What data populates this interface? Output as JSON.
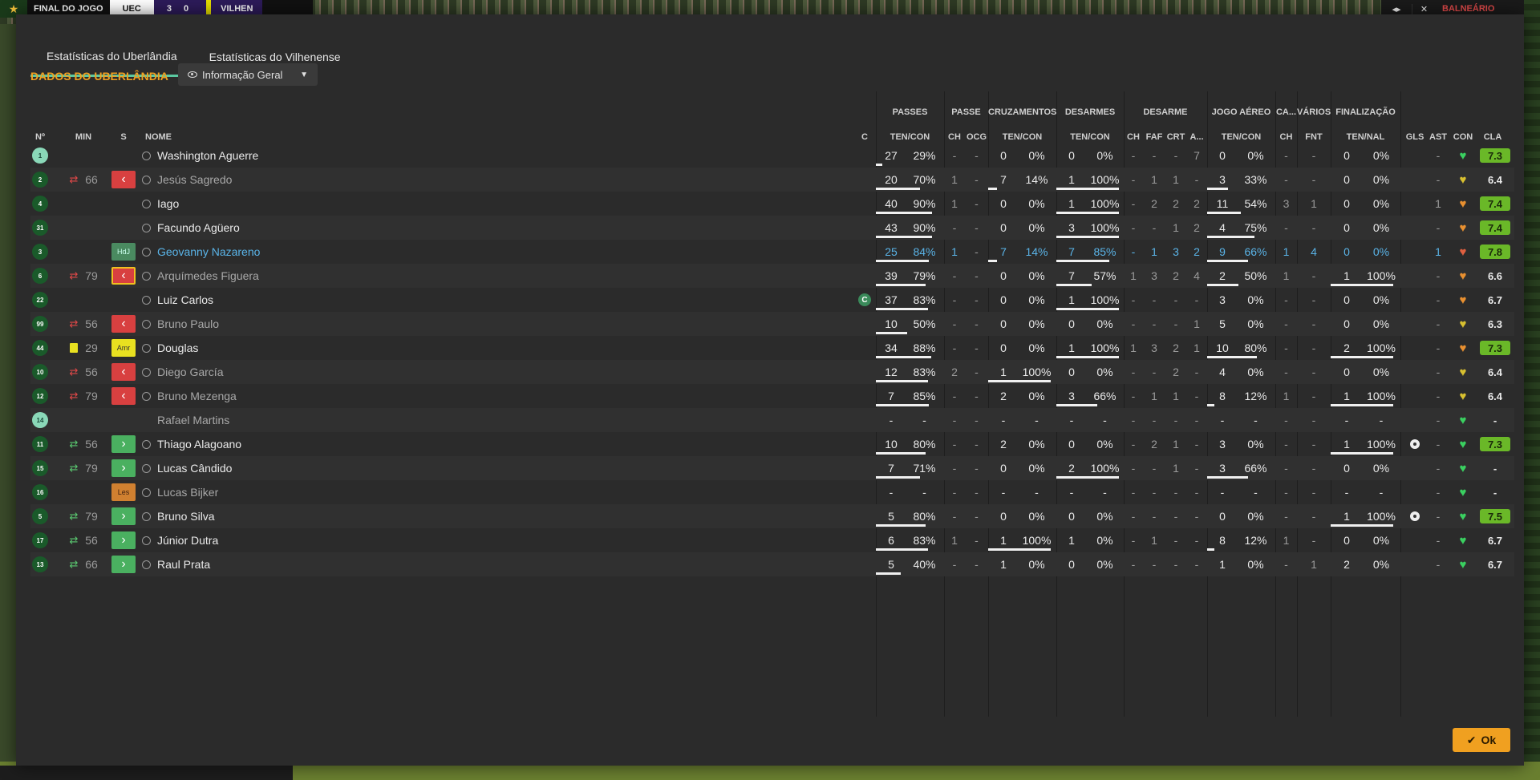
{
  "scorebar": {
    "logo": "★",
    "status": "FINAL DO JOGO",
    "team1": "UEC",
    "score": "3 0",
    "team2": "VILHEN"
  },
  "topright": {
    "b1": "◂▸",
    "b2": "✕",
    "label": "BALNEÁRIO"
  },
  "tabs": [
    "Estatísticas do Uberlândia",
    "Estatísticas do Vilhenense"
  ],
  "section_title": "DADOS DO UBERLÂNDIA",
  "dropdown": {
    "label": "Informação Geral"
  },
  "groups": {
    "passes": "PASSES",
    "passe": "PASSE",
    "cruz": "CRUZAMENTOS",
    "desarmes": "DESARMES",
    "desarme": "DESARME",
    "aereo": "JOGO AÉREO",
    "ca": "CA...",
    "varios": "VÁRIOS",
    "final": "FINALIZAÇÃO"
  },
  "headers": {
    "num": "Nº",
    "min": "MIN",
    "s": "S",
    "nome": "NOME",
    "c": "C",
    "passes_tc": "TEN/CON",
    "passe_ch": "CH",
    "passe_ocg": "OCG",
    "cruz_tc": "TEN/CON",
    "des_tc": "TEN/CON",
    "d_ch": "CH",
    "d_faf": "FAF",
    "d_crt": "CRT",
    "d_a": "A...",
    "aer_tc": "TEN/CON",
    "ca_ch": "CH",
    "v_fnt": "FNT",
    "fin_tn": "TEN/NAL",
    "gls": "GLS",
    "ast": "AST",
    "con": "CON",
    "cla": "CLA"
  },
  "ok_button": {
    "icon": "✔",
    "label": "Ok"
  },
  "players": [
    {
      "num": "1",
      "gk": true,
      "min": "",
      "sub": "",
      "status": "",
      "name": "Washington Aguerre",
      "style": "",
      "capt": false,
      "p": [
        "27",
        "29%"
      ],
      "ch": "-",
      "ocg": "-",
      "cr": [
        "0",
        "0%"
      ],
      "de": [
        "0",
        "0%"
      ],
      "dch": "-",
      "faf": "-",
      "crt": "-",
      "da": "7",
      "ae": [
        "0",
        "0%"
      ],
      "cach": "-",
      "fnt": "-",
      "fi": [
        "0",
        "0%"
      ],
      "gls": "",
      "ast": "-",
      "con": "green",
      "cla": "7.3",
      "cla_good": true,
      "bars": {
        "p": 0.1,
        "cr": 0,
        "de": 0,
        "ae": 0,
        "fi": 0
      }
    },
    {
      "num": "2",
      "gk": false,
      "min": "66",
      "sub": "out",
      "status": "out",
      "name": "Jesús Sagredo",
      "style": "dim",
      "capt": false,
      "p": [
        "20",
        "70%"
      ],
      "ch": "1",
      "ocg": "-",
      "cr": [
        "7",
        "14%"
      ],
      "de": [
        "1",
        "100%"
      ],
      "dch": "-",
      "faf": "1",
      "crt": "1",
      "da": "-",
      "ae": [
        "3",
        "33%"
      ],
      "cach": "-",
      "fnt": "-",
      "fi": [
        "0",
        "0%"
      ],
      "gls": "",
      "ast": "-",
      "con": "yellow",
      "cla": "6.4",
      "cla_good": false,
      "bars": {
        "p": 0.7,
        "cr": 0.14,
        "de": 1,
        "ae": 0.33,
        "fi": 0
      }
    },
    {
      "num": "4",
      "gk": false,
      "min": "",
      "sub": "",
      "status": "",
      "name": "Iago",
      "style": "",
      "capt": false,
      "p": [
        "40",
        "90%"
      ],
      "ch": "1",
      "ocg": "-",
      "cr": [
        "0",
        "0%"
      ],
      "de": [
        "1",
        "100%"
      ],
      "dch": "-",
      "faf": "2",
      "crt": "2",
      "da": "2",
      "ae": [
        "11",
        "54%"
      ],
      "cach": "3",
      "fnt": "1",
      "fi": [
        "0",
        "0%"
      ],
      "gls": "",
      "ast": "1",
      "con": "orange",
      "cla": "7.4",
      "cla_good": true,
      "bars": {
        "p": 0.9,
        "cr": 0,
        "de": 1,
        "ae": 0.54,
        "fi": 0
      }
    },
    {
      "num": "31",
      "gk": false,
      "min": "",
      "sub": "",
      "status": "",
      "name": "Facundo Agüero",
      "style": "",
      "capt": false,
      "p": [
        "43",
        "90%"
      ],
      "ch": "-",
      "ocg": "-",
      "cr": [
        "0",
        "0%"
      ],
      "de": [
        "3",
        "100%"
      ],
      "dch": "-",
      "faf": "-",
      "crt": "1",
      "da": "2",
      "ae": [
        "4",
        "75%"
      ],
      "cach": "-",
      "fnt": "-",
      "fi": [
        "0",
        "0%"
      ],
      "gls": "",
      "ast": "-",
      "con": "orange",
      "cla": "7.4",
      "cla_good": true,
      "bars": {
        "p": 0.9,
        "cr": 0,
        "de": 1,
        "ae": 0.75,
        "fi": 0
      }
    },
    {
      "num": "3",
      "gk": false,
      "min": "",
      "sub": "",
      "status": "hdj",
      "name": "Geovanny Nazareno",
      "style": "hl",
      "capt": false,
      "p": [
        "25",
        "84%"
      ],
      "ch": "1",
      "ocg": "-",
      "cr": [
        "7",
        "14%"
      ],
      "de": [
        "7",
        "85%"
      ],
      "dch": "-",
      "faf": "1",
      "crt": "3",
      "da": "2",
      "ae": [
        "9",
        "66%"
      ],
      "cach": "1",
      "fnt": "4",
      "fi": [
        "0",
        "0%"
      ],
      "gls": "",
      "ast": "1",
      "con": "red",
      "cla": "7.8",
      "cla_good": true,
      "bars": {
        "p": 0.84,
        "cr": 0.14,
        "de": 0.85,
        "ae": 0.66,
        "fi": 0
      }
    },
    {
      "num": "6",
      "gk": false,
      "min": "79",
      "sub": "out",
      "status": "outbox",
      "name": "Arquímedes Figuera",
      "style": "dim",
      "capt": false,
      "p": [
        "39",
        "79%"
      ],
      "ch": "-",
      "ocg": "-",
      "cr": [
        "0",
        "0%"
      ],
      "de": [
        "7",
        "57%"
      ],
      "dch": "1",
      "faf": "3",
      "crt": "2",
      "da": "4",
      "ae": [
        "2",
        "50%"
      ],
      "cach": "1",
      "fnt": "-",
      "fi": [
        "1",
        "100%"
      ],
      "gls": "",
      "ast": "-",
      "con": "orange",
      "cla": "6.6",
      "cla_good": false,
      "bars": {
        "p": 0.79,
        "cr": 0,
        "de": 0.57,
        "ae": 0.5,
        "fi": 1
      }
    },
    {
      "num": "22",
      "gk": false,
      "min": "",
      "sub": "",
      "status": "",
      "name": "Luiz Carlos",
      "style": "",
      "capt": true,
      "p": [
        "37",
        "83%"
      ],
      "ch": "-",
      "ocg": "-",
      "cr": [
        "0",
        "0%"
      ],
      "de": [
        "1",
        "100%"
      ],
      "dch": "-",
      "faf": "-",
      "crt": "-",
      "da": "-",
      "ae": [
        "3",
        "0%"
      ],
      "cach": "-",
      "fnt": "-",
      "fi": [
        "0",
        "0%"
      ],
      "gls": "",
      "ast": "-",
      "con": "orange",
      "cla": "6.7",
      "cla_good": false,
      "bars": {
        "p": 0.83,
        "cr": 0,
        "de": 1,
        "ae": 0,
        "fi": 0
      }
    },
    {
      "num": "99",
      "gk": false,
      "min": "56",
      "sub": "out",
      "status": "out",
      "name": "Bruno Paulo",
      "style": "dim",
      "capt": false,
      "p": [
        "10",
        "50%"
      ],
      "ch": "-",
      "ocg": "-",
      "cr": [
        "0",
        "0%"
      ],
      "de": [
        "0",
        "0%"
      ],
      "dch": "-",
      "faf": "-",
      "crt": "-",
      "da": "1",
      "ae": [
        "5",
        "0%"
      ],
      "cach": "-",
      "fnt": "-",
      "fi": [
        "0",
        "0%"
      ],
      "gls": "",
      "ast": "-",
      "con": "yellow",
      "cla": "6.3",
      "cla_good": false,
      "bars": {
        "p": 0.5,
        "cr": 0,
        "de": 0,
        "ae": 0,
        "fi": 0
      }
    },
    {
      "num": "44",
      "gk": false,
      "min": "29",
      "sub": "card",
      "status": "amr",
      "name": "Douglas",
      "style": "",
      "capt": false,
      "p": [
        "34",
        "88%"
      ],
      "ch": "-",
      "ocg": "-",
      "cr": [
        "0",
        "0%"
      ],
      "de": [
        "1",
        "100%"
      ],
      "dch": "1",
      "faf": "3",
      "crt": "2",
      "da": "1",
      "ae": [
        "10",
        "80%"
      ],
      "cach": "-",
      "fnt": "-",
      "fi": [
        "2",
        "100%"
      ],
      "gls": "",
      "ast": "-",
      "con": "orange",
      "cla": "7.3",
      "cla_good": true,
      "bars": {
        "p": 0.88,
        "cr": 0,
        "de": 1,
        "ae": 0.8,
        "fi": 1
      }
    },
    {
      "num": "10",
      "gk": false,
      "min": "56",
      "sub": "out",
      "status": "out",
      "name": "Diego García",
      "style": "dim",
      "capt": false,
      "p": [
        "12",
        "83%"
      ],
      "ch": "2",
      "ocg": "-",
      "cr": [
        "1",
        "100%"
      ],
      "de": [
        "0",
        "0%"
      ],
      "dch": "-",
      "faf": "-",
      "crt": "2",
      "da": "-",
      "ae": [
        "4",
        "0%"
      ],
      "cach": "-",
      "fnt": "-",
      "fi": [
        "0",
        "0%"
      ],
      "gls": "",
      "ast": "-",
      "con": "yellow",
      "cla": "6.4",
      "cla_good": false,
      "bars": {
        "p": 0.83,
        "cr": 1,
        "de": 0,
        "ae": 0,
        "fi": 0
      }
    },
    {
      "num": "12",
      "gk": false,
      "min": "79",
      "sub": "out",
      "status": "out",
      "name": "Bruno Mezenga",
      "style": "dim",
      "capt": false,
      "p": [
        "7",
        "85%"
      ],
      "ch": "-",
      "ocg": "-",
      "cr": [
        "2",
        "0%"
      ],
      "de": [
        "3",
        "66%"
      ],
      "dch": "-",
      "faf": "1",
      "crt": "1",
      "da": "-",
      "ae": [
        "8",
        "12%"
      ],
      "cach": "1",
      "fnt": "-",
      "fi": [
        "1",
        "100%"
      ],
      "gls": "",
      "ast": "-",
      "con": "yellow",
      "cla": "6.4",
      "cla_good": false,
      "bars": {
        "p": 0.85,
        "cr": 0,
        "de": 0.66,
        "ae": 0.12,
        "fi": 1
      }
    },
    {
      "num": "14",
      "gk": true,
      "min": "",
      "sub": "",
      "status": "",
      "name": "Rafael Martins",
      "style": "dim",
      "capt": false,
      "p": [
        "-",
        "-"
      ],
      "ch": "-",
      "ocg": "-",
      "cr": [
        "-",
        "-"
      ],
      "de": [
        "-",
        "-"
      ],
      "dch": "-",
      "faf": "-",
      "crt": "-",
      "da": "-",
      "ae": [
        "-",
        "-"
      ],
      "cach": "-",
      "fnt": "-",
      "fi": [
        "-",
        "-"
      ],
      "gls": "",
      "ast": "-",
      "con": "green",
      "cla": "-",
      "cla_good": false,
      "bars": {
        "p": 0,
        "cr": 0,
        "de": 0,
        "ae": 0,
        "fi": 0
      }
    },
    {
      "num": "11",
      "gk": false,
      "min": "56",
      "sub": "in",
      "status": "in",
      "name": "Thiago Alagoano",
      "style": "",
      "capt": false,
      "p": [
        "10",
        "80%"
      ],
      "ch": "-",
      "ocg": "-",
      "cr": [
        "2",
        "0%"
      ],
      "de": [
        "0",
        "0%"
      ],
      "dch": "-",
      "faf": "2",
      "crt": "1",
      "da": "-",
      "ae": [
        "3",
        "0%"
      ],
      "cach": "-",
      "fnt": "-",
      "fi": [
        "1",
        "100%"
      ],
      "gls": "ball",
      "ast": "-",
      "con": "green",
      "cla": "7.3",
      "cla_good": true,
      "bars": {
        "p": 0.8,
        "cr": 0,
        "de": 0,
        "ae": 0,
        "fi": 1
      }
    },
    {
      "num": "15",
      "gk": false,
      "min": "79",
      "sub": "in",
      "status": "in",
      "name": "Lucas Cândido",
      "style": "",
      "capt": false,
      "p": [
        "7",
        "71%"
      ],
      "ch": "-",
      "ocg": "-",
      "cr": [
        "0",
        "0%"
      ],
      "de": [
        "2",
        "100%"
      ],
      "dch": "-",
      "faf": "-",
      "crt": "1",
      "da": "-",
      "ae": [
        "3",
        "66%"
      ],
      "cach": "-",
      "fnt": "-",
      "fi": [
        "0",
        "0%"
      ],
      "gls": "",
      "ast": "-",
      "con": "green",
      "cla": "-",
      "cla_good": false,
      "bars": {
        "p": 0.71,
        "cr": 0,
        "de": 1,
        "ae": 0.66,
        "fi": 0
      }
    },
    {
      "num": "16",
      "gk": false,
      "min": "",
      "sub": "",
      "status": "les",
      "name": "Lucas Bijker",
      "style": "dim",
      "capt": false,
      "p": [
        "-",
        "-"
      ],
      "ch": "-",
      "ocg": "-",
      "cr": [
        "-",
        "-"
      ],
      "de": [
        "-",
        "-"
      ],
      "dch": "-",
      "faf": "-",
      "crt": "-",
      "da": "-",
      "ae": [
        "-",
        "-"
      ],
      "cach": "-",
      "fnt": "-",
      "fi": [
        "-",
        "-"
      ],
      "gls": "",
      "ast": "-",
      "con": "green",
      "cla": "-",
      "cla_good": false,
      "bars": {
        "p": 0,
        "cr": 0,
        "de": 0,
        "ae": 0,
        "fi": 0
      }
    },
    {
      "num": "5",
      "gk": false,
      "min": "79",
      "sub": "in",
      "status": "in",
      "name": "Bruno Silva",
      "style": "",
      "capt": false,
      "p": [
        "5",
        "80%"
      ],
      "ch": "-",
      "ocg": "-",
      "cr": [
        "0",
        "0%"
      ],
      "de": [
        "0",
        "0%"
      ],
      "dch": "-",
      "faf": "-",
      "crt": "-",
      "da": "-",
      "ae": [
        "0",
        "0%"
      ],
      "cach": "-",
      "fnt": "-",
      "fi": [
        "1",
        "100%"
      ],
      "gls": "ball",
      "ast": "-",
      "con": "green",
      "cla": "7.5",
      "cla_good": true,
      "bars": {
        "p": 0.8,
        "cr": 0,
        "de": 0,
        "ae": 0,
        "fi": 1
      }
    },
    {
      "num": "17",
      "gk": false,
      "min": "56",
      "sub": "in",
      "status": "in",
      "name": "Júnior Dutra",
      "style": "",
      "capt": false,
      "p": [
        "6",
        "83%"
      ],
      "ch": "1",
      "ocg": "-",
      "cr": [
        "1",
        "100%"
      ],
      "de": [
        "1",
        "0%"
      ],
      "dch": "-",
      "faf": "1",
      "crt": "-",
      "da": "-",
      "ae": [
        "8",
        "12%"
      ],
      "cach": "1",
      "fnt": "-",
      "fi": [
        "0",
        "0%"
      ],
      "gls": "",
      "ast": "-",
      "con": "green",
      "cla": "6.7",
      "cla_good": false,
      "bars": {
        "p": 0.83,
        "cr": 1,
        "de": 0,
        "ae": 0.12,
        "fi": 0
      }
    },
    {
      "num": "13",
      "gk": false,
      "min": "66",
      "sub": "in",
      "status": "in",
      "name": "Raul Prata",
      "style": "",
      "capt": false,
      "p": [
        "5",
        "40%"
      ],
      "ch": "-",
      "ocg": "-",
      "cr": [
        "1",
        "0%"
      ],
      "de": [
        "0",
        "0%"
      ],
      "dch": "-",
      "faf": "-",
      "crt": "-",
      "da": "-",
      "ae": [
        "1",
        "0%"
      ],
      "cach": "-",
      "fnt": "1",
      "fi": [
        "2",
        "0%"
      ],
      "gls": "",
      "ast": "-",
      "con": "green",
      "cla": "6.7",
      "cla_good": false,
      "bars": {
        "p": 0.4,
        "cr": 0,
        "de": 0,
        "ae": 0,
        "fi": 0
      }
    }
  ],
  "colors": {
    "accent": "#f0a020",
    "tab_underline": "#5ac8a0",
    "good_rating": "#6ab828"
  }
}
